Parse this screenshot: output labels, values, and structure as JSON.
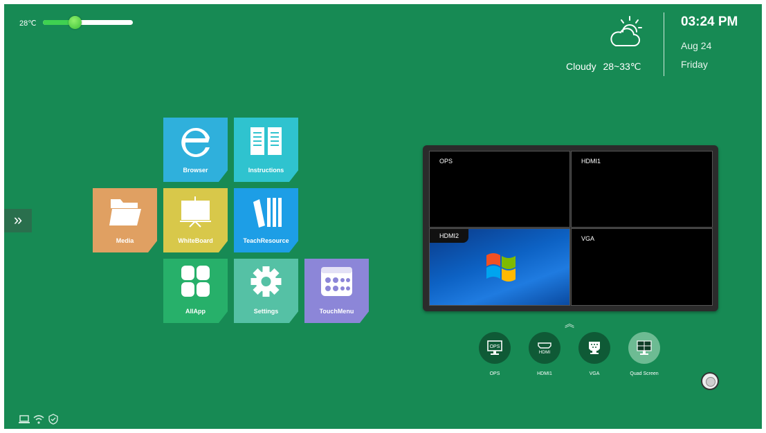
{
  "temperature": {
    "label": "28℃",
    "level": 0.35
  },
  "weather": {
    "condition": "Cloudy",
    "range": "28~33℃",
    "icon": "cloudy-icon"
  },
  "clock": {
    "time": "03:24 PM",
    "date": "Aug 24",
    "day": "Friday"
  },
  "side_panel": {
    "expand_icon": "double-chevron-right-icon",
    "glyph": "»"
  },
  "apps": [
    {
      "label": "Browser",
      "icon": "browser-icon",
      "color": "#2fb0dc"
    },
    {
      "label": "Instructions",
      "icon": "book-icon",
      "color": "#2fc3cf"
    },
    {
      "label": "Media",
      "icon": "folder-icon",
      "color": "#e0a062"
    },
    {
      "label": "WhiteBoard",
      "icon": "whiteboard-icon",
      "color": "#d8c84a"
    },
    {
      "label": "TeachResource",
      "icon": "books-icon",
      "color": "#1d9ee6"
    },
    {
      "label": "AllApp",
      "icon": "grid-icon",
      "color": "#27b06a"
    },
    {
      "label": "Settings",
      "icon": "gear-icon",
      "color": "#55c1a5"
    },
    {
      "label": "TouchMenu",
      "icon": "calendar-menu-icon",
      "color": "#8c86d8"
    }
  ],
  "preview": {
    "panes": [
      {
        "label": "OPS"
      },
      {
        "label": "HDMI1"
      },
      {
        "label": "HDMI2"
      },
      {
        "label": "VGA"
      }
    ]
  },
  "sources": [
    {
      "label": "OPS",
      "icon": "ops-monitor-icon",
      "badge": "OPS"
    },
    {
      "label": "HDMI1",
      "icon": "hdmi-port-icon",
      "badge": "HDMI"
    },
    {
      "label": "VGA",
      "icon": "vga-port-icon",
      "badge": ""
    },
    {
      "label": "Quad Screen",
      "icon": "quad-screen-icon",
      "badge": ""
    }
  ],
  "status_bar": {
    "icons": [
      "laptop-icon",
      "wifi-icon",
      "shield-icon"
    ]
  }
}
